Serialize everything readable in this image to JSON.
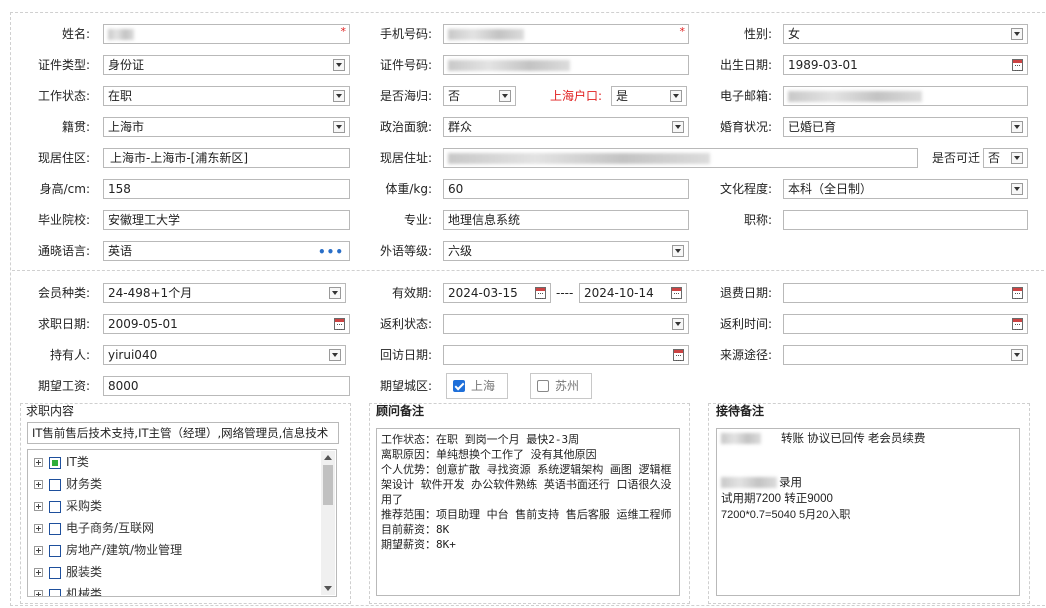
{
  "basic": {
    "name_label": "姓名:",
    "phone_label": "手机号码:",
    "gender_label": "性别:",
    "gender_value": "女",
    "id_type_label": "证件类型:",
    "id_type_value": "身份证",
    "id_no_label": "证件号码:",
    "birth_label": "出生日期:",
    "birth_value": "1989-03-01",
    "work_status_label": "工作状态:",
    "work_status_value": "在职",
    "returnee_label": "是否海归:",
    "returnee_value": "否",
    "sh_hukou_label": "上海户口:",
    "sh_hukou_value": "是",
    "email_label": "电子邮箱:",
    "native_label": "籍贯:",
    "native_value": "上海市",
    "political_label": "政治面貌:",
    "political_value": "群众",
    "marital_label": "婚育状况:",
    "marital_value": "已婚已育",
    "residence_label": "现居住区:",
    "residence_value": "上海市-上海市-[浦东新区]",
    "address_label": "现居住址:",
    "movable_label": "是否可迁",
    "movable_value": "否",
    "height_label": "身高/cm:",
    "height_value": "158",
    "weight_label": "体重/kg:",
    "weight_value": "60",
    "education_label": "文化程度:",
    "education_value": "本科（全日制）",
    "school_label": "毕业院校:",
    "school_value": "安徽理工大学",
    "major_label": "专业:",
    "major_value": "地理信息系统",
    "title_label": "职称:",
    "language_label": "通晓语言:",
    "language_value": "英语",
    "language_btn": "•••",
    "foreign_level_label": "外语等级:",
    "foreign_level_value": "六级",
    "required_mark": "*"
  },
  "member": {
    "member_type_label": "会员种类:",
    "member_type_value": "24-498+1个月",
    "valid_label": "有效期:",
    "valid_from": "2024-03-15",
    "valid_sep": "----",
    "valid_to": "2024-10-14",
    "refund_date_label": "退费日期:",
    "job_date_label": "求职日期:",
    "job_date_value": "2009-05-01",
    "rebate_status_label": "返利状态:",
    "rebate_time_label": "返利时间:",
    "holder_label": "持有人:",
    "holder_value": "yirui040",
    "revisit_label": "回访日期:",
    "source_label": "来源途径:",
    "salary_label": "期望工资:",
    "salary_value": "8000",
    "city_label": "期望城区:",
    "city_options": [
      {
        "label": "上海",
        "checked": true
      },
      {
        "label": "苏州",
        "checked": false
      }
    ]
  },
  "panels": {
    "job_title": "求职内容",
    "job_summary": "IT售前售后技术支持,IT主管（经理）,网络管理员,信息技术",
    "tree_items": [
      {
        "label": "IT类",
        "state": "partial"
      },
      {
        "label": "财务类",
        "state": "none"
      },
      {
        "label": "采购类",
        "state": "none"
      },
      {
        "label": "电子商务/互联网",
        "state": "none"
      },
      {
        "label": "房地产/建筑/物业管理",
        "state": "none"
      },
      {
        "label": "服装类",
        "state": "none"
      },
      {
        "label": "机械类",
        "state": "none"
      }
    ],
    "advisor_title": "顾问备注",
    "advisor_text": "工作状态：在职 到岗一个月 最快2-3周\n离职原因：单纯想换个工作了 没有其他原因\n个人优势：创意扩散 寻找资源 系统逻辑架构 画图 逻辑框架设计 软件开发 办公软件熟练 英语书面还行 口语很久没用了\n推荐范围：项目助理 中台 售前支持 售后客服 运维工程师\n目前薪资：8K\n期望薪资：8K+",
    "reception_title": "接待备注",
    "reception_line1": "转账 协议已回传  老会员续费",
    "reception_line2": "录用",
    "reception_line3": "试用期7200 转正9000",
    "reception_line4": "7200*0.7=5040 5月20入职"
  }
}
